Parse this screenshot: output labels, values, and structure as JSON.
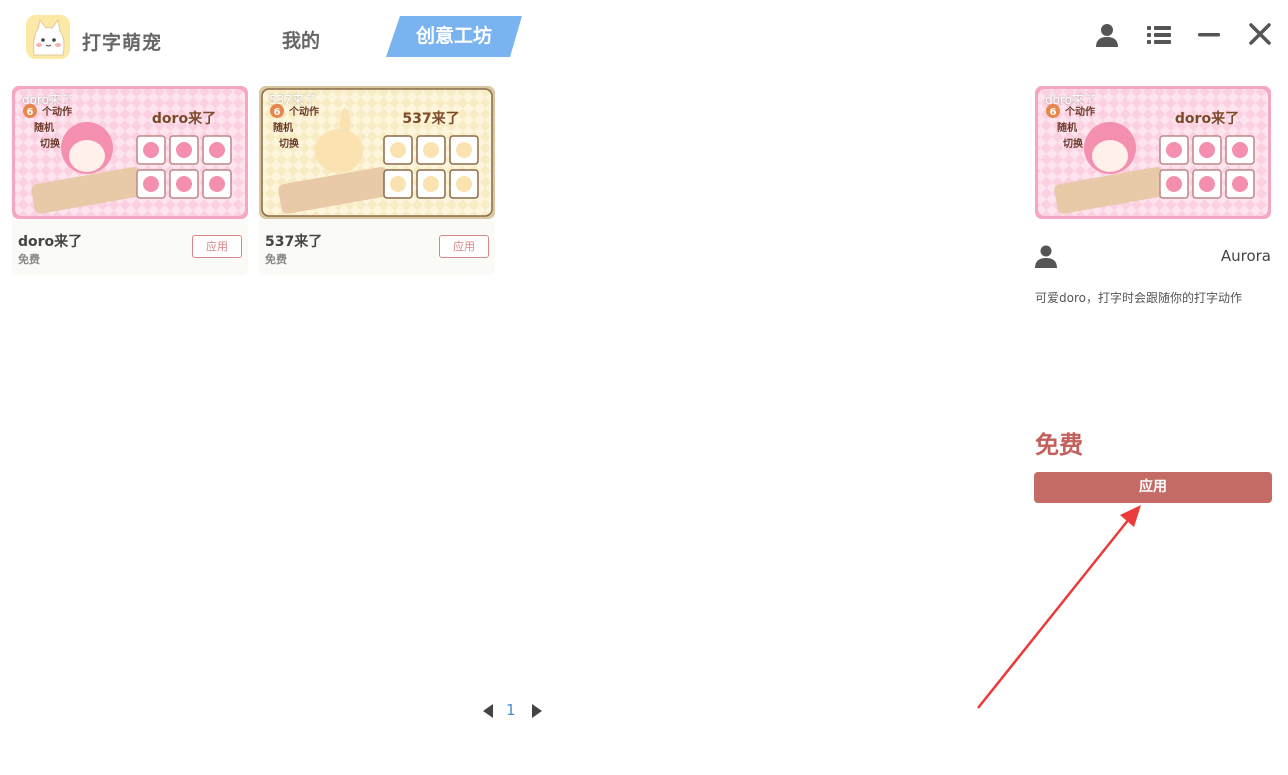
{
  "app": {
    "name": "打字萌宠"
  },
  "tabs": [
    {
      "label": "我的"
    },
    {
      "label": "创意工坊"
    }
  ],
  "window_controls": [
    "user-icon",
    "list-icon",
    "minimize-icon",
    "close-icon"
  ],
  "cards": [
    {
      "thumb_label": "doro来了",
      "name": "doro来了",
      "price": "免费",
      "apply_label": "应用",
      "banner_title": "doro来了",
      "banner_count": "6",
      "banner_actions": "个动作",
      "banner_random": "随机",
      "banner_switch": "切换"
    },
    {
      "thumb_label": "537来了",
      "name": "537来了",
      "price": "免费",
      "apply_label": "应用",
      "banner_title": "537来了",
      "banner_count": "6",
      "banner_actions": "个动作",
      "banner_random": "随机",
      "banner_switch": "切换"
    }
  ],
  "detail": {
    "thumb_label": "doro来了",
    "banner_title": "doro来了",
    "banner_count": "6",
    "banner_actions": "个动作",
    "banner_random": "随机",
    "banner_switch": "切换",
    "author": "Aurora",
    "description": "可爱doro，打字时会跟随你的打字动作",
    "price": "免费",
    "apply_label": "应用"
  },
  "pagination": {
    "current": "1"
  },
  "colors": {
    "accent_blue": "#7ab4f0",
    "apply_red": "#c46b66",
    "price_red": "#c4605c",
    "page_blue": "#4a90d9"
  }
}
